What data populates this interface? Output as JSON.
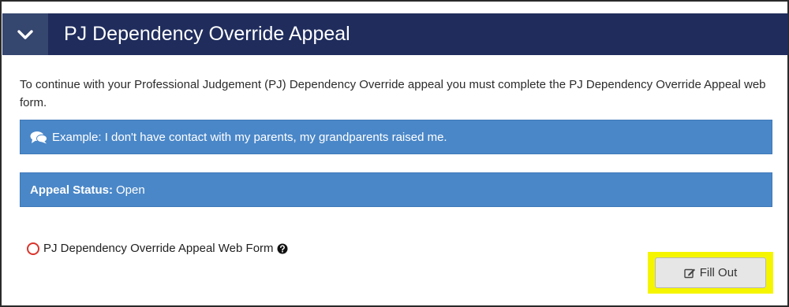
{
  "header": {
    "title": "PJ Dependency Override Appeal",
    "toggle_icon": "chevron-down-icon"
  },
  "intro_text": "To continue with your Professional Judgement (PJ) Dependency Override appeal you must complete the PJ Dependency Override Appeal web form.",
  "example_box": {
    "icon": "comments-icon",
    "text": "Example: I don't have contact with my parents, my grandparents raised me."
  },
  "status_box": {
    "label": "Appeal Status:",
    "value": "Open"
  },
  "form_item": {
    "status_icon": "empty-circle-icon",
    "label": "PJ Dependency Override Appeal Web Form",
    "help_icon": "question-circle-icon"
  },
  "fill_out_button": {
    "icon": "edit-icon",
    "label": "Fill Out",
    "highlight_color": "#f5f500"
  },
  "colors": {
    "header_bg": "#1f2c5c",
    "toggle_bg": "#35466f",
    "info_bar": "#4a87c8",
    "incomplete_marker": "#d9342b"
  }
}
